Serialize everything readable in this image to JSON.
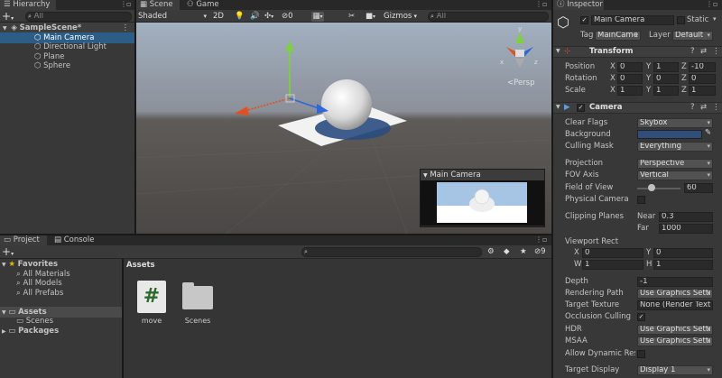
{
  "hierarchy": {
    "tab": "Hierarchy",
    "search_placeholder": "All",
    "scene": "SampleScene*",
    "items": [
      "Main Camera",
      "Directional Light",
      "Plane",
      "Sphere"
    ]
  },
  "scene_view": {
    "tab_scene": "Scene",
    "tab_game": "Game",
    "shading": "Shaded",
    "mode_2d": "2D",
    "fx_count": "0",
    "gizmos": "Gizmos",
    "search_placeholder": "All",
    "persp": "<Persp"
  },
  "camera_preview": {
    "title": "Main Camera"
  },
  "project": {
    "tab_project": "Project",
    "tab_console": "Console",
    "favorites": "Favorites",
    "fav_items": [
      "All Materials",
      "All Models",
      "All Prefabs"
    ],
    "assets": "Assets",
    "asset_folders": [
      "Scenes"
    ],
    "packages": "Packages",
    "breadcrumb": "Assets",
    "files": [
      {
        "name": "move",
        "type": "script"
      },
      {
        "name": "Scenes",
        "type": "folder"
      }
    ],
    "hidden_count": "9"
  },
  "inspector": {
    "tab": "Inspector",
    "object_name": "Main Camera",
    "static_label": "Static",
    "tag_label": "Tag",
    "tag_value": "MainCame",
    "layer_label": "Layer",
    "layer_value": "Default",
    "transform": {
      "title": "Transform",
      "rows": [
        {
          "label": "Position",
          "x": "0",
          "y": "1",
          "z": "-10"
        },
        {
          "label": "Rotation",
          "x": "0",
          "y": "0",
          "z": "0"
        },
        {
          "label": "Scale",
          "x": "1",
          "y": "1",
          "z": "1"
        }
      ]
    },
    "camera": {
      "title": "Camera",
      "clear_flags_label": "Clear Flags",
      "clear_flags": "Skybox",
      "background_label": "Background",
      "background_color": "#314D79",
      "culling_mask_label": "Culling Mask",
      "culling_mask": "Everything",
      "projection_label": "Projection",
      "projection": "Perspective",
      "fov_axis_label": "FOV Axis",
      "fov_axis": "Vertical",
      "fov_label": "Field of View",
      "fov": "60",
      "fov_level": 0.33,
      "physical_label": "Physical Camera",
      "clipping_label": "Clipping Planes",
      "near_label": "Near",
      "near": "0.3",
      "far_label": "Far",
      "far": "1000",
      "viewport_label": "Viewport Rect",
      "vx": "0",
      "vy": "0",
      "vw": "1",
      "vh": "1",
      "depth_label": "Depth",
      "depth": "-1",
      "render_path_label": "Rendering Path",
      "render_path": "Use Graphics Setti",
      "target_tex_label": "Target Texture",
      "target_tex": "None (Render Text",
      "occlusion_label": "Occlusion Culling",
      "hdr_label": "HDR",
      "hdr": "Use Graphics Setti",
      "msaa_label": "MSAA",
      "msaa": "Use Graphics Setti",
      "dyn_res_label": "Allow Dynamic Resol",
      "target_display_label": "Target Display",
      "target_display": "Display 1"
    }
  }
}
